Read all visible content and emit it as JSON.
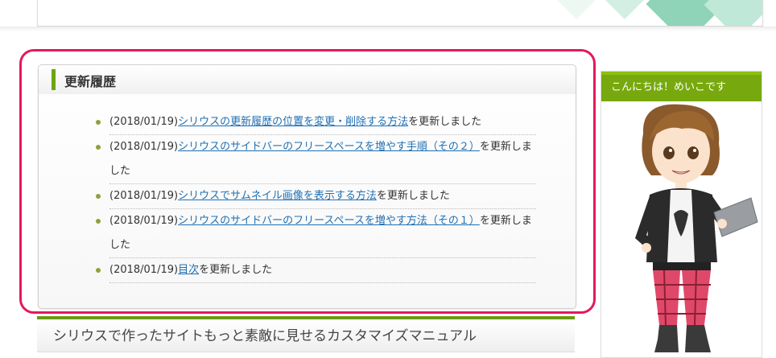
{
  "history": {
    "title": "更新履歴",
    "items": [
      {
        "date": "(2018/01/19)",
        "link": "シリウスの更新履歴の位置を変更・削除する方法",
        "suffix": "を更新しました"
      },
      {
        "date": "(2018/01/19)",
        "link": "シリウスのサイドバーのフリースペースを増やす手順（その２）",
        "suffix": "を更新しました"
      },
      {
        "date": "(2018/01/19)",
        "link": "シリウスでサムネイル画像を表示する方法",
        "suffix": "を更新しました"
      },
      {
        "date": "(2018/01/19)",
        "link": "シリウスのサイドバーのフリースペースを増やす方法（その１）",
        "suffix": "を更新しました"
      },
      {
        "date": "(2018/01/19)",
        "link": "目次",
        "suffix": "を更新しました"
      }
    ]
  },
  "article": {
    "title": "シリウスで作ったサイトもっと素敵に見せるカスタマイズマニュアル"
  },
  "sidebar": {
    "title": "こんにちは！めいこです"
  },
  "colors": {
    "accent_green": "#77a90f",
    "link_blue": "#1f6fb2",
    "highlight_pink": "#e4185f"
  }
}
